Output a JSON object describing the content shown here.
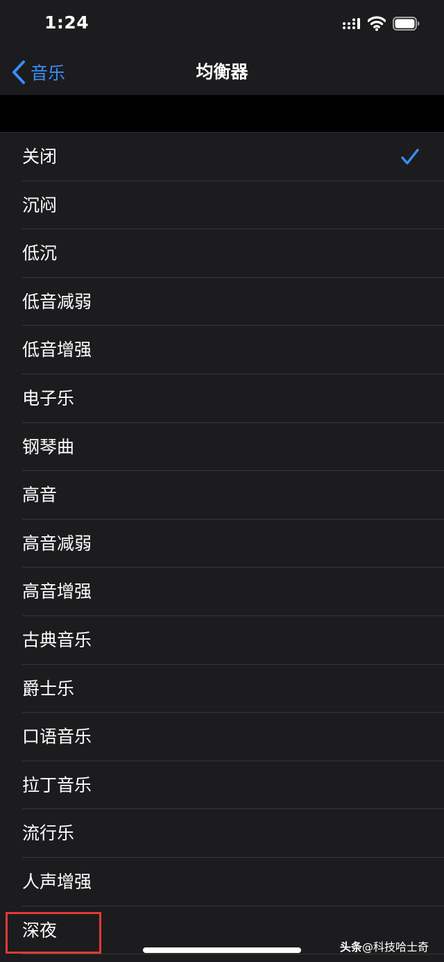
{
  "status_bar": {
    "time": "1:24",
    "signal_icon": "cellular-signal-icon",
    "wifi_icon": "wifi-icon",
    "battery_icon": "battery-icon"
  },
  "nav": {
    "back_label": "音乐",
    "back_icon": "chevron-left-icon",
    "title": "均衡器"
  },
  "equalizer": {
    "items": [
      {
        "label": "关闭",
        "selected": true
      },
      {
        "label": "沉闷",
        "selected": false
      },
      {
        "label": "低沉",
        "selected": false
      },
      {
        "label": "低音减弱",
        "selected": false
      },
      {
        "label": "低音增强",
        "selected": false
      },
      {
        "label": "电子乐",
        "selected": false
      },
      {
        "label": "钢琴曲",
        "selected": false
      },
      {
        "label": "高音",
        "selected": false
      },
      {
        "label": "高音减弱",
        "selected": false
      },
      {
        "label": "高音增强",
        "selected": false
      },
      {
        "label": "古典音乐",
        "selected": false
      },
      {
        "label": "爵士乐",
        "selected": false
      },
      {
        "label": "口语音乐",
        "selected": false
      },
      {
        "label": "拉丁音乐",
        "selected": false
      },
      {
        "label": "流行乐",
        "selected": false
      },
      {
        "label": "人声增强",
        "selected": false
      },
      {
        "label": "深夜",
        "selected": false
      }
    ],
    "selected_icon": "checkmark-icon"
  },
  "watermark": {
    "brand": "头条",
    "handle": "@科技哈士奇"
  },
  "colors": {
    "accent": "#3a8ef6",
    "background": "#1c1c1e",
    "highlight": "#e53935"
  }
}
